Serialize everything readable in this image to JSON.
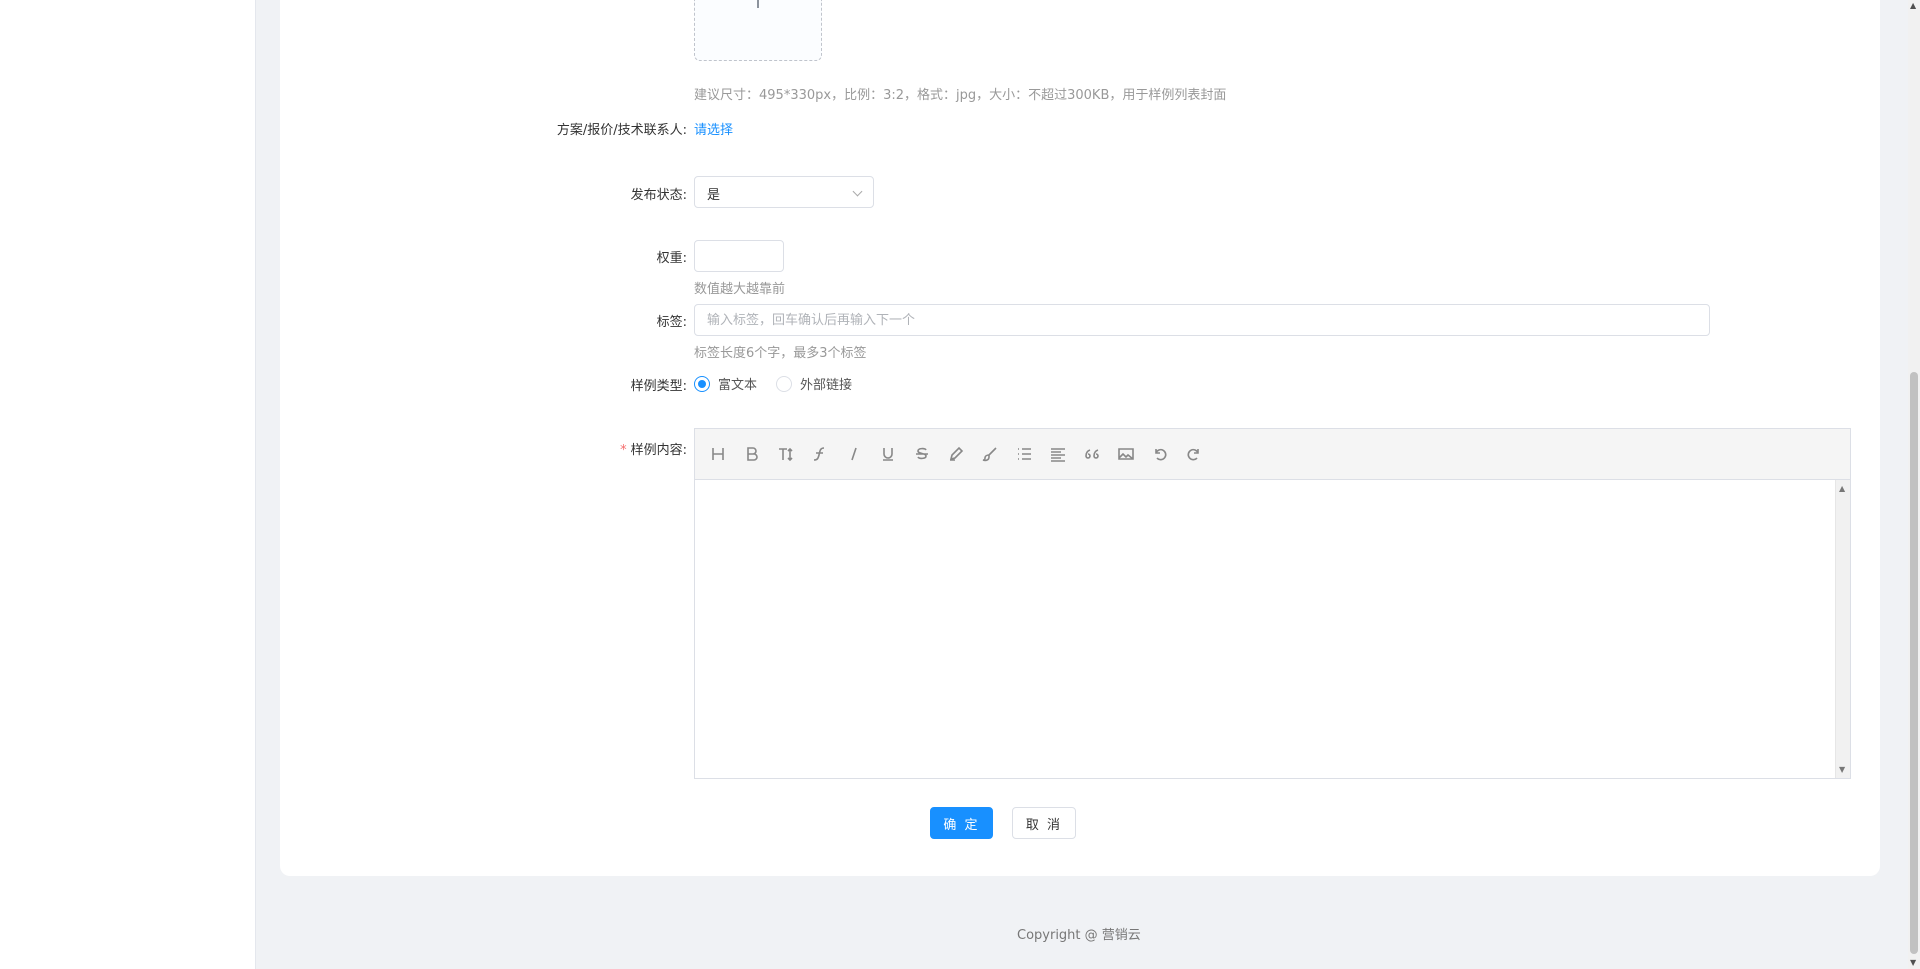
{
  "upload": {
    "hint": "建议尺寸：495*330px，比例：3:2，格式：jpg，大小：不超过300KB，用于样例列表封面"
  },
  "contact": {
    "label": "方案/报价/技术联系人:",
    "link": "请选择"
  },
  "publish": {
    "label": "发布状态:",
    "value": "是"
  },
  "weight": {
    "label": "权重:",
    "value": "",
    "hint": "数值越大越靠前"
  },
  "tags": {
    "label": "标签:",
    "placeholder": "输入标签，回车确认后再输入下一个",
    "hint": "标签长度6个字，最多3个标签"
  },
  "sample_type": {
    "label": "样例类型:",
    "options": [
      "富文本",
      "外部链接"
    ],
    "selected": "富文本"
  },
  "content": {
    "required_mark": "*",
    "label": "样例内容:",
    "toolbar": [
      "heading-icon",
      "bold-icon",
      "font-size-icon",
      "font-family-icon",
      "italic-icon",
      "underline-icon",
      "strikethrough-icon",
      "text-color-icon",
      "background-color-icon",
      "list-icon",
      "align-icon",
      "quote-icon",
      "image-icon",
      "undo-icon",
      "redo-icon"
    ]
  },
  "actions": {
    "confirm": "确 定",
    "cancel": "取 消"
  },
  "footer": {
    "copyright": "Copyright @ 营销云"
  },
  "colors": {
    "primary": "#1890ff",
    "required": "#f56c6c",
    "page_bg": "#f0f2f5"
  }
}
